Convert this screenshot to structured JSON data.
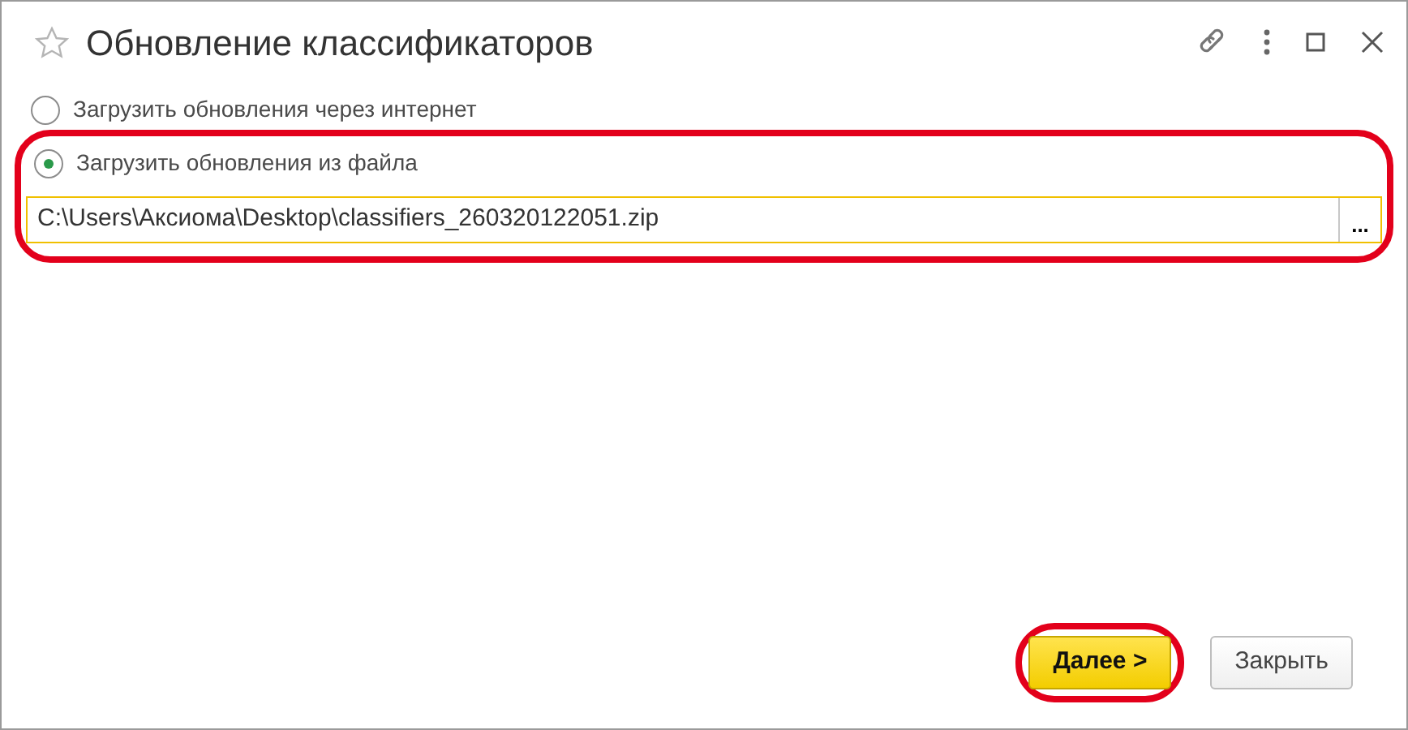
{
  "window": {
    "title": "Обновление классификаторов",
    "starred": false
  },
  "options": [
    {
      "label": "Загрузить обновления через интернет",
      "selected": false,
      "highlighted": false
    },
    {
      "label": "Загрузить обновления из файла",
      "selected": true,
      "highlighted": true,
      "file_path": "C:\\Users\\Аксиома\\Desktop\\classifiers_260320122051.zip",
      "browse_label": "..."
    }
  ],
  "buttons": [
    {
      "label": "Далее >",
      "kind": "primary",
      "highlighted": true
    },
    {
      "label": "Закрыть",
      "kind": "secondary",
      "highlighted": false
    }
  ]
}
